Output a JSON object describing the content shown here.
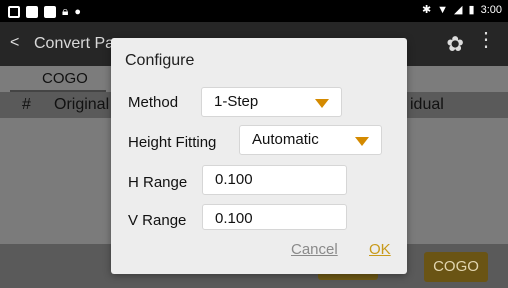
{
  "status_bar": {
    "left_icons": [
      "image-icon",
      "square-icon",
      "square-icon",
      "lock-icon",
      "android-icon"
    ],
    "right_icons": [
      "bluetooth-icon",
      "wifi-icon",
      "signal-icon",
      "battery-icon"
    ],
    "time": "3:00"
  },
  "app_bar": {
    "back_glyph": "<",
    "title": "Convert Pa",
    "gear_glyph": "✿",
    "more_glyph": "⋮"
  },
  "tabs": [
    {
      "label": "COGO"
    }
  ],
  "table_header": {
    "col_hash": "#",
    "col_original": "Original",
    "col_residual": "idual"
  },
  "bottom_buttons": {
    "cogo_label": "COGO"
  },
  "dialog": {
    "title": "Configure",
    "method": {
      "label": "Method",
      "value": "1-Step"
    },
    "height_fitting": {
      "label": "Height Fitting",
      "value": "Automatic"
    },
    "h_range": {
      "label": "H Range",
      "value": "0.100"
    },
    "v_range": {
      "label": "V Range",
      "value": "0.100"
    },
    "cancel_label": "Cancel",
    "ok_label": "OK"
  },
  "colors": {
    "accent": "#c89a1a",
    "caret": "#d48a00",
    "cancel": "#8a8a8a",
    "dialog_bg": "#ededed",
    "status_bar_bg": "#000000"
  }
}
